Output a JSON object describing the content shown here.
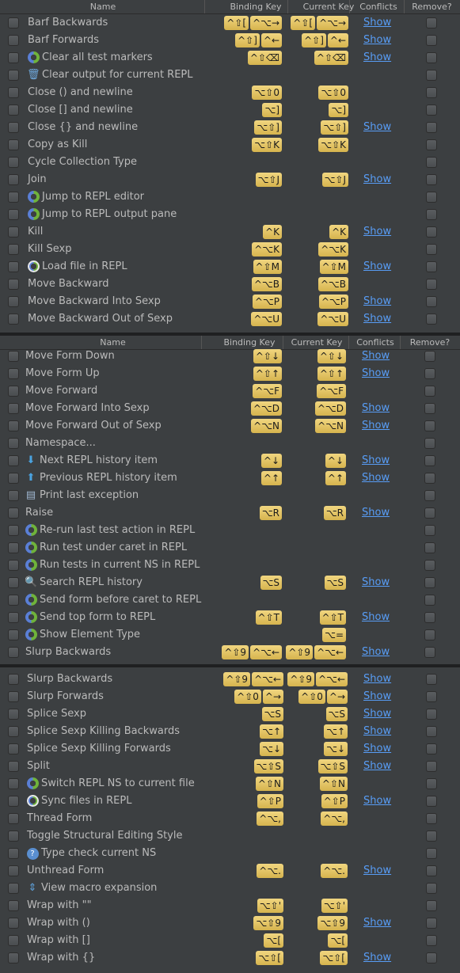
{
  "header": {
    "name": "Name",
    "binding": "Binding Key",
    "current": "Current Key",
    "conflicts": "Conflicts",
    "remove": "Remove?"
  },
  "colors": {
    "key_bg": "#e7c86a",
    "link": "#589df6",
    "bg": "#3c3f41"
  },
  "sections": [
    {
      "rows": [
        {
          "name": "Barf Backwards",
          "icon": "",
          "binding": [
            "^⇧[",
            "^⌥→"
          ],
          "current": [
            "^⇧[",
            "^⌥→"
          ],
          "conflict": "Show"
        },
        {
          "name": "Barf Forwards",
          "icon": "",
          "binding": [
            "^⇧]",
            "^←"
          ],
          "current": [
            "^⇧]",
            "^←"
          ],
          "conflict": "Show"
        },
        {
          "name": "Clear all test markers",
          "icon": "cursive",
          "binding": [
            "^⇧⌫"
          ],
          "current": [
            "^⇧⌫"
          ],
          "conflict": "Show"
        },
        {
          "name": "Clear output for current REPL",
          "icon": "trash",
          "binding": [],
          "current": [],
          "conflict": ""
        },
        {
          "name": "Close () and newline",
          "icon": "",
          "binding": [
            "⌥⇧0"
          ],
          "current": [
            "⌥⇧0"
          ],
          "conflict": ""
        },
        {
          "name": "Close [] and newline",
          "icon": "",
          "binding": [
            "⌥]"
          ],
          "current": [
            "⌥]"
          ],
          "conflict": ""
        },
        {
          "name": "Close {} and newline",
          "icon": "",
          "binding": [
            "⌥⇧]"
          ],
          "current": [
            "⌥⇧]"
          ],
          "conflict": "Show"
        },
        {
          "name": "Copy as Kill",
          "icon": "",
          "binding": [
            "⌥⇧K"
          ],
          "current": [
            "⌥⇧K"
          ],
          "conflict": ""
        },
        {
          "name": "Cycle Collection Type",
          "icon": "",
          "binding": [],
          "current": [],
          "conflict": ""
        },
        {
          "name": "Join",
          "icon": "",
          "binding": [
            "⌥⇧J"
          ],
          "current": [
            "⌥⇧J"
          ],
          "conflict": "Show"
        },
        {
          "name": "Jump to REPL editor",
          "icon": "cursive",
          "binding": [],
          "current": [],
          "conflict": ""
        },
        {
          "name": "Jump to REPL output pane",
          "icon": "cursive",
          "binding": [],
          "current": [],
          "conflict": ""
        },
        {
          "name": "Kill",
          "icon": "",
          "binding": [
            "^K"
          ],
          "current": [
            "^K"
          ],
          "conflict": "Show"
        },
        {
          "name": "Kill Sexp",
          "icon": "",
          "binding": [
            "^⌥K"
          ],
          "current": [
            "^⌥K"
          ],
          "conflict": ""
        },
        {
          "name": "Load file in REPL",
          "icon": "cursive-load",
          "binding": [
            "^⇧M"
          ],
          "current": [
            "^⇧M"
          ],
          "conflict": "Show"
        },
        {
          "name": "Move Backward",
          "icon": "",
          "binding": [
            "^⌥B"
          ],
          "current": [
            "^⌥B"
          ],
          "conflict": ""
        },
        {
          "name": "Move Backward Into Sexp",
          "icon": "",
          "binding": [
            "^⌥P"
          ],
          "current": [
            "^⌥P"
          ],
          "conflict": "Show"
        },
        {
          "name": "Move Backward Out of Sexp",
          "icon": "",
          "binding": [
            "^⌥U"
          ],
          "current": [
            "^⌥U"
          ],
          "conflict": "Show"
        }
      ]
    },
    {
      "rows": [
        {
          "name": "Move Form Down",
          "icon": "",
          "binding": [
            "^⇧↓"
          ],
          "current": [
            "^⇧↓"
          ],
          "conflict": "Show"
        },
        {
          "name": "Move Form Up",
          "icon": "",
          "binding": [
            "^⇧↑"
          ],
          "current": [
            "^⇧↑"
          ],
          "conflict": "Show"
        },
        {
          "name": "Move Forward",
          "icon": "",
          "binding": [
            "^⌥F"
          ],
          "current": [
            "^⌥F"
          ],
          "conflict": ""
        },
        {
          "name": "Move Forward Into Sexp",
          "icon": "",
          "binding": [
            "^⌥D"
          ],
          "current": [
            "^⌥D"
          ],
          "conflict": "Show"
        },
        {
          "name": "Move Forward Out of Sexp",
          "icon": "",
          "binding": [
            "^⌥N"
          ],
          "current": [
            "^⌥N"
          ],
          "conflict": "Show"
        },
        {
          "name": "Namespace...",
          "icon": "",
          "binding": [],
          "current": [],
          "conflict": ""
        },
        {
          "name": "Next REPL history item",
          "icon": "arrow-down",
          "binding": [
            "^↓"
          ],
          "current": [
            "^↓"
          ],
          "conflict": "Show"
        },
        {
          "name": "Previous REPL history item",
          "icon": "arrow-up",
          "binding": [
            "^↑"
          ],
          "current": [
            "^↑"
          ],
          "conflict": "Show"
        },
        {
          "name": "Print last exception",
          "icon": "exception",
          "binding": [],
          "current": [],
          "conflict": ""
        },
        {
          "name": "Raise",
          "icon": "",
          "binding": [
            "⌥R"
          ],
          "current": [
            "⌥R"
          ],
          "conflict": "Show"
        },
        {
          "name": "Re-run last test action in REPL",
          "icon": "cursive",
          "binding": [],
          "current": [],
          "conflict": ""
        },
        {
          "name": "Run test under caret in REPL",
          "icon": "cursive",
          "binding": [],
          "current": [],
          "conflict": ""
        },
        {
          "name": "Run tests in current NS in REPL",
          "icon": "cursive",
          "binding": [],
          "current": [],
          "conflict": ""
        },
        {
          "name": "Search REPL history",
          "icon": "search",
          "binding": [
            "⌥S"
          ],
          "current": [
            "⌥S"
          ],
          "conflict": "Show"
        },
        {
          "name": "Send form before caret to REPL",
          "icon": "cursive",
          "binding": [],
          "current": [],
          "conflict": ""
        },
        {
          "name": "Send top form to REPL",
          "icon": "cursive",
          "binding": [
            "^⇧T"
          ],
          "current": [
            "^⇧T"
          ],
          "conflict": "Show"
        },
        {
          "name": "Show Element Type",
          "icon": "cursive",
          "binding": [],
          "current": [
            "⌥="
          ],
          "conflict": ""
        },
        {
          "name": "Slurp Backwards",
          "icon": "",
          "binding": [
            "^⇧9",
            "^⌥←"
          ],
          "current": [
            "^⇧9",
            "^⌥←"
          ],
          "conflict": "Show"
        }
      ]
    },
    {
      "rows": [
        {
          "name": "Slurp Backwards",
          "icon": "",
          "binding": [
            "^⇧9",
            "^⌥←"
          ],
          "current": [
            "^⇧9",
            "^⌥←"
          ],
          "conflict": "Show"
        },
        {
          "name": "Slurp Forwards",
          "icon": "",
          "binding": [
            "^⇧0",
            "^→"
          ],
          "current": [
            "^⇧0",
            "^→"
          ],
          "conflict": "Show"
        },
        {
          "name": "Splice Sexp",
          "icon": "",
          "binding": [
            "⌥S"
          ],
          "current": [
            "⌥S"
          ],
          "conflict": "Show"
        },
        {
          "name": "Splice Sexp Killing Backwards",
          "icon": "",
          "binding": [
            "⌥↑"
          ],
          "current": [
            "⌥↑"
          ],
          "conflict": "Show"
        },
        {
          "name": "Splice Sexp Killing Forwards",
          "icon": "",
          "binding": [
            "⌥↓"
          ],
          "current": [
            "⌥↓"
          ],
          "conflict": "Show"
        },
        {
          "name": "Split",
          "icon": "",
          "binding": [
            "⌥⇧S"
          ],
          "current": [
            "⌥⇧S"
          ],
          "conflict": "Show"
        },
        {
          "name": "Switch REPL NS to current file",
          "icon": "cursive",
          "binding": [
            "^⇧N"
          ],
          "current": [
            "^⇧N"
          ],
          "conflict": ""
        },
        {
          "name": "Sync files in REPL",
          "icon": "cursive-load",
          "binding": [
            "^⇧P"
          ],
          "current": [
            "^⇧P"
          ],
          "conflict": "Show"
        },
        {
          "name": "Thread Form",
          "icon": "",
          "binding": [
            "^⌥,"
          ],
          "current": [
            "^⌥,"
          ],
          "conflict": ""
        },
        {
          "name": "Toggle Structural Editing Style",
          "icon": "",
          "binding": [],
          "current": [],
          "conflict": ""
        },
        {
          "name": "Type check current NS",
          "icon": "typed",
          "binding": [],
          "current": [],
          "conflict": ""
        },
        {
          "name": "Unthread Form",
          "icon": "",
          "binding": [
            "^⌥."
          ],
          "current": [
            "^⌥."
          ],
          "conflict": "Show"
        },
        {
          "name": "View macro expansion",
          "icon": "macro",
          "binding": [],
          "current": [],
          "conflict": ""
        },
        {
          "name": "Wrap with \"\"",
          "icon": "",
          "binding": [
            "⌥⇧'"
          ],
          "current": [
            "⌥⇧'"
          ],
          "conflict": ""
        },
        {
          "name": "Wrap with ()",
          "icon": "",
          "binding": [
            "⌥⇧9"
          ],
          "current": [
            "⌥⇧9"
          ],
          "conflict": "Show"
        },
        {
          "name": "Wrap with []",
          "icon": "",
          "binding": [
            "⌥["
          ],
          "current": [
            "⌥["
          ],
          "conflict": ""
        },
        {
          "name": "Wrap with {}",
          "icon": "",
          "binding": [
            "⌥⇧["
          ],
          "current": [
            "⌥⇧["
          ],
          "conflict": "Show"
        }
      ]
    }
  ]
}
